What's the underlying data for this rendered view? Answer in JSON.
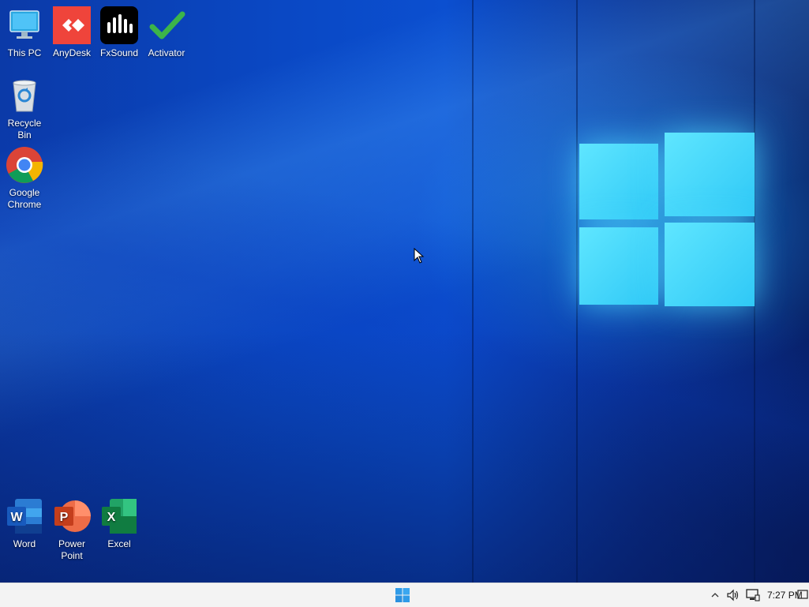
{
  "desktop": {
    "icons": [
      {
        "label": "This PC",
        "icon": "computer-icon"
      },
      {
        "label": "AnyDesk",
        "icon": "anydesk-icon"
      },
      {
        "label": "FxSound",
        "icon": "fxsound-icon"
      },
      {
        "label": "Activator",
        "icon": "checkmark-icon"
      },
      {
        "label": "Recycle Bin",
        "icon": "recycle-bin-icon"
      },
      {
        "label": "Google Chrome",
        "icon": "chrome-icon"
      },
      {
        "label": "Word",
        "icon": "word-icon"
      },
      {
        "label": "Power Point",
        "icon": "powerpoint-icon"
      },
      {
        "label": "Excel",
        "icon": "excel-icon"
      }
    ],
    "colors": {
      "anydesk": "#ef443b",
      "fxsound": "#000000",
      "activator": "#3cb54a",
      "word": "#185abd",
      "powerpoint": "#c43e1c",
      "excel": "#107c41"
    }
  },
  "taskbar": {
    "start_icon": "windows-start-icon",
    "tray": {
      "chevron_icon": "chevron-up-icon",
      "volume_icon": "speaker-icon",
      "network_icon": "network-icon",
      "time": "7:27 PM",
      "notification_icon": "notification-icon"
    }
  }
}
